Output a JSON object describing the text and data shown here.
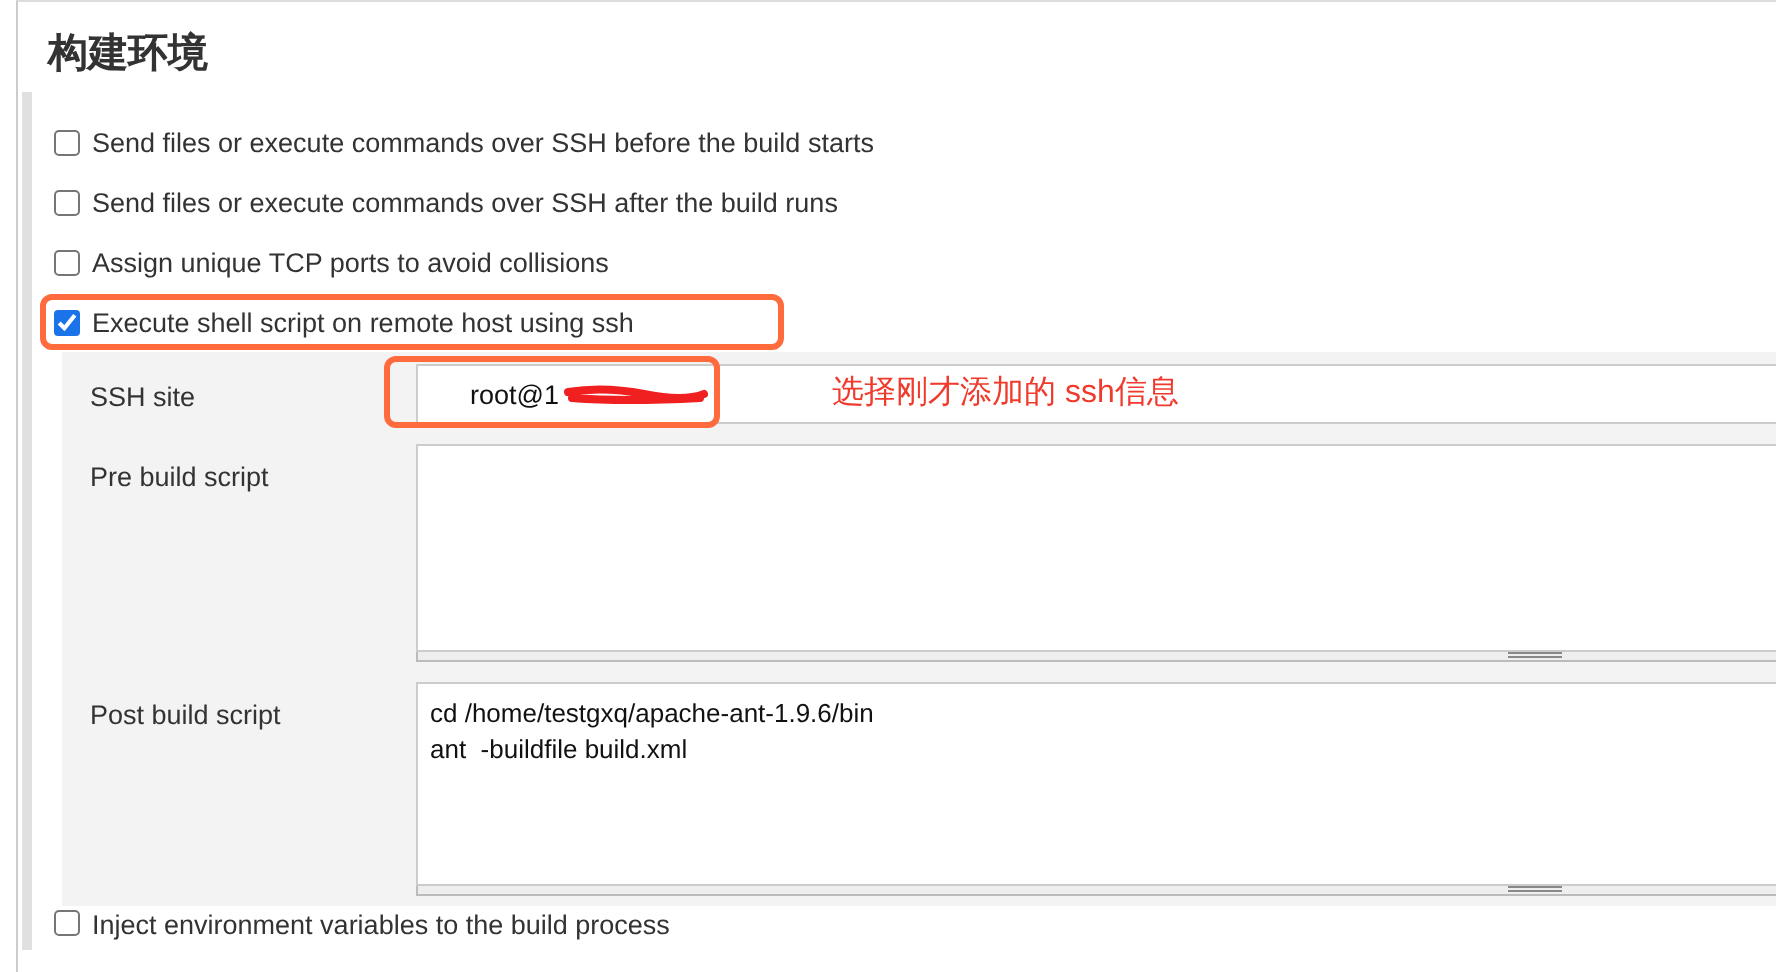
{
  "section_title": "构建环境",
  "options": [
    {
      "label": "Send files or execute commands over SSH before the build starts",
      "checked": false,
      "highlighted": false
    },
    {
      "label": "Send files or execute commands over SSH after the build runs",
      "checked": false,
      "highlighted": false
    },
    {
      "label": "Assign unique TCP ports to avoid collisions",
      "checked": false,
      "highlighted": false
    },
    {
      "label": "Execute shell script on remote host using ssh",
      "checked": true,
      "highlighted": true
    }
  ],
  "ssh_config": {
    "ssh_site": {
      "label": "SSH site",
      "value": "root@1",
      "redacted": true,
      "highlighted": true
    },
    "annotation": "选择刚才添加的 ssh信息",
    "pre_build_script": {
      "label": "Pre build script"
    },
    "post_build_script": {
      "label": "Post build script",
      "lines": [
        "cd /home/testgxq/apache-ant-1.9.6/bin",
        "ant  -buildfile build.xml"
      ]
    }
  },
  "trailing_option": {
    "label": "Inject environment variables to the build process",
    "checked": false
  }
}
